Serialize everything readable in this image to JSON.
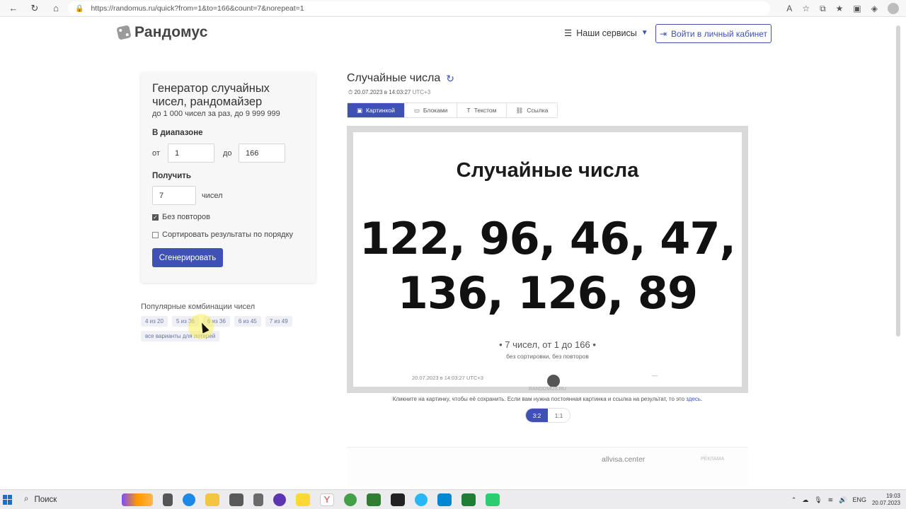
{
  "browser": {
    "url": "https://randomus.ru/quick?from=1&to=166&count=7&norepeat=1"
  },
  "header": {
    "logo_text": "Рандомус",
    "services_label": "Наши сервисы",
    "login_label": "Войти в личный кабинет"
  },
  "generator": {
    "title": "Генератор случайных чисел, рандомайзер",
    "subtitle": "до 1 000 чисел за раз, до 9 999 999",
    "range_label": "В диапазоне",
    "from_label": "от",
    "from_value": "1",
    "to_label": "до",
    "to_value": "166",
    "get_label": "Получить",
    "count_value": "7",
    "count_unit": "чисел",
    "norepeat_label": "Без повторов",
    "norepeat_checked": true,
    "sort_label": "Сортировать результаты по порядку",
    "sort_checked": false,
    "generate_button": "Сгенерировать"
  },
  "popular": {
    "title": "Популярные комбинации чисел",
    "chips": [
      "4 из 20",
      "5 из 36",
      "6 из 36",
      "6 из 45",
      "7 из 49",
      "все варианты для лотерей"
    ]
  },
  "result": {
    "title": "Случайные числа",
    "datetime": "20.07.2023 в 14:03:27",
    "timezone": "UTC+3",
    "tabs": [
      "Картинкой",
      "Блоками",
      "Текстом",
      "Ссылка"
    ],
    "active_tab": "Картинкой",
    "card_title": "Случайные числа",
    "numbers_line1": "122, 96, 46, 47,",
    "numbers_line2": "136, 126, 89",
    "card_meta": "• 7 чисел, от 1 до 166 •",
    "card_meta2": "без сортировки, без повторов",
    "card_footer_date": "20.07.2023 в 14:03:27 UTC+3",
    "card_footer_dash": "—",
    "card_brand": "RANDOMUS.RU",
    "save_note": "Кликните на картинку, чтобы её сохранить. Если вам нужна постоянная картинка и ссылка на результат, то это",
    "save_link": "здесь",
    "ratios": [
      "3:2",
      "1:1"
    ],
    "active_ratio": "3:2"
  },
  "ad": {
    "text": "allvisa.center",
    "label": "РЕКЛАМА"
  },
  "taskbar": {
    "search_placeholder": "Поиск",
    "lang": "ENG",
    "time": "19:03",
    "date": "20.07.2023"
  },
  "colors": {
    "accent": "#3f51b5",
    "card_border": "#d9d9d9"
  }
}
